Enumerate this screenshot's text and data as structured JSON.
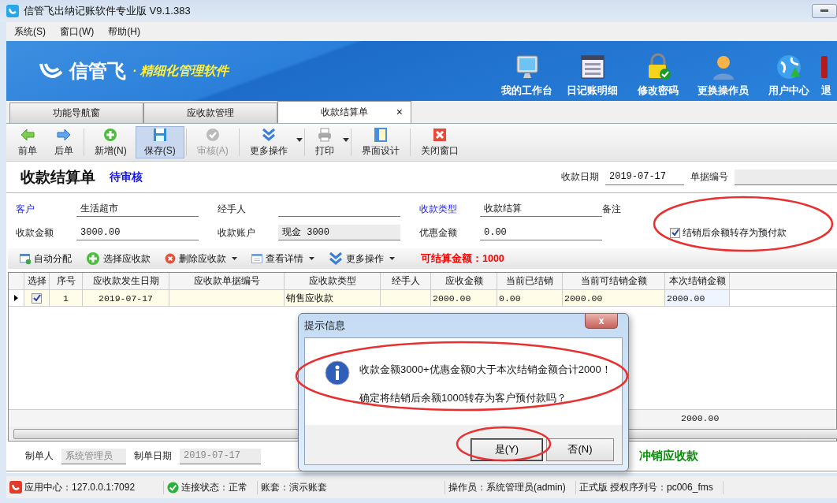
{
  "window": {
    "title": "信管飞出纳记账软件专业版 V9.1.383"
  },
  "menu": [
    "系统(S)",
    "窗口(W)",
    "帮助(H)"
  ],
  "banner": {
    "logo": "信管飞",
    "slogan": "· 精细化管理软件",
    "nav": [
      {
        "label": "我的工作台",
        "kind": "monitor"
      },
      {
        "label": "日记账明细",
        "kind": "table"
      },
      {
        "label": "修改密码",
        "kind": "lock"
      },
      {
        "label": "更换操作员",
        "kind": "user"
      },
      {
        "label": "用户中心",
        "kind": "globe"
      },
      {
        "label": "退",
        "kind": "exit"
      }
    ]
  },
  "tabs": [
    {
      "label": "功能导航窗",
      "selected": false
    },
    {
      "label": "应收款管理",
      "selected": false
    },
    {
      "label": "收款结算单",
      "selected": true,
      "close": "×"
    }
  ],
  "toolbar": [
    {
      "label": "前单",
      "kind": "prev",
      "selected": false,
      "disabled": false
    },
    {
      "label": "后单",
      "kind": "next",
      "selected": false,
      "disabled": false
    },
    {
      "label": "新增(N)",
      "kind": "add",
      "selected": false,
      "disabled": false
    },
    {
      "label": "保存(S)",
      "kind": "save",
      "selected": true,
      "disabled": false
    },
    {
      "label": "审核(A)",
      "kind": "check",
      "selected": false,
      "disabled": true
    },
    {
      "label": "更多操作",
      "kind": "more",
      "selected": false,
      "disabled": false,
      "dropdown": true
    },
    {
      "label": "打印",
      "kind": "print",
      "selected": false,
      "disabled": false,
      "dropdown": true
    },
    {
      "label": "界面设计",
      "kind": "design",
      "selected": false,
      "disabled": false
    },
    {
      "label": "关闭窗口",
      "kind": "close",
      "selected": false,
      "disabled": false
    }
  ],
  "header": {
    "title": "收款结算单",
    "status": "待审核",
    "date_label": "收款日期",
    "date": "2019-07-17",
    "number_label": "单据编号"
  },
  "form": {
    "rows": [
      [
        {
          "label": "客户",
          "required": true,
          "value": "生活超市",
          "readonly": false
        },
        {
          "label": "经手人",
          "required": false,
          "readonly": false
        },
        {
          "label": "收款类型",
          "required": true,
          "value": "收款结算",
          "readonly": false
        },
        {
          "label": "备注",
          "required": false,
          "nofield": true
        }
      ],
      [
        {
          "label": "收款金额",
          "required": false,
          "value": "3000.00",
          "readonly": false
        },
        {
          "label": "收款账户",
          "required": false,
          "value": "现金 3000",
          "readonly": true
        },
        {
          "label": "优惠金额",
          "required": false,
          "value": "0.00",
          "readonly": false
        }
      ]
    ],
    "transfer_checkbox": {
      "label": "结销后余额转存为预付款",
      "checked": true
    }
  },
  "grid_toolbar": {
    "buttons": [
      {
        "label": "自动分配",
        "kind": "auto",
        "dropdown": false
      },
      {
        "label": "选择应收款",
        "kind": "add",
        "dropdown": false
      },
      {
        "label": "删除应收款",
        "kind": "delete",
        "dropdown": true
      },
      {
        "label": "查看详情",
        "kind": "detail",
        "dropdown": true
      },
      {
        "label": "更多操作",
        "kind": "more",
        "dropdown": true
      }
    ],
    "available": "可结算金额：1000"
  },
  "table": {
    "columns": [
      "选择",
      "序号",
      "应收款发生日期",
      "应收款单据编号",
      "应收款类型",
      "经手人",
      "应收金额",
      "当前已结销",
      "当前可结销金额",
      "本次结销金额"
    ],
    "rows": [
      {
        "current": true,
        "checked": true,
        "cells": [
          "",
          "1",
          "2019-07-17",
          "",
          "销售应收款",
          "",
          "2000.00",
          "0.00",
          "2000.00",
          "2000.00"
        ]
      }
    ],
    "summary": {
      "column_10": "2000.00"
    }
  },
  "footer": {
    "maker_label": "制单人",
    "maker": "系统管理员",
    "date_label": "制单日期",
    "date": "2019-07-17",
    "link": "冲销应收款"
  },
  "status_bar": [
    "应用中心：127.0.0.1:7092",
    "连接状态：正常",
    "账套：演示账套",
    "操作员：系统管理员(admin)",
    "正式版 授权序列号：pc006_fms"
  ],
  "dialog": {
    "title": "提示信息",
    "close": "x",
    "lines": [
      "收款金额3000+优惠金额0大于本次结销金额合计2000！",
      "确定将结销后余额1000转存为客户预付款吗？"
    ],
    "buttons": [
      {
        "label": "是(Y)",
        "selected": true
      },
      {
        "label": "否(N)",
        "selected": false
      }
    ]
  }
}
